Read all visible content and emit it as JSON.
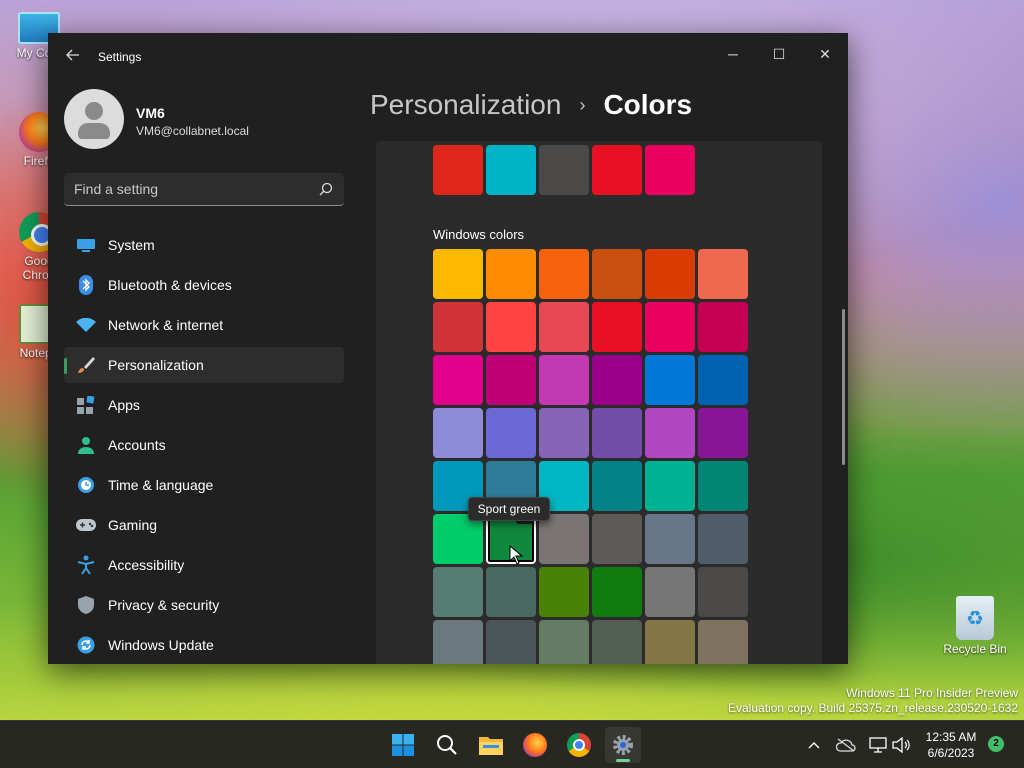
{
  "desktop": {
    "icons": [
      {
        "label": "My Com",
        "icon": "computer-icon"
      },
      {
        "label": "Firefo",
        "icon": "firefox-icon"
      },
      {
        "label": "Goog Chron",
        "icon": "chrome-icon"
      },
      {
        "label": "Notepa",
        "icon": "notepad-icon"
      },
      {
        "label": "Recycle Bin",
        "icon": "recycle-bin-icon"
      }
    ],
    "watermark": {
      "line1": "Windows 11 Pro Insider Preview",
      "line2": "Evaluation copy. Build 25375.zn_release.230520-1632"
    }
  },
  "window": {
    "title": "Settings",
    "back_icon": "back-arrow-icon",
    "controls": {
      "minimize": "─",
      "maximize": "☐",
      "close": "✕"
    },
    "user": {
      "name": "VM6",
      "email": "VM6@collabnet.local"
    },
    "search": {
      "placeholder": "Find a setting",
      "value": ""
    },
    "nav": [
      {
        "label": "System",
        "icon": "system-icon",
        "color": "#3aa0e6"
      },
      {
        "label": "Bluetooth & devices",
        "icon": "bluetooth-icon",
        "color": "#3a8ee6"
      },
      {
        "label": "Network & internet",
        "icon": "wifi-icon",
        "color": "#4cb3f0"
      },
      {
        "label": "Personalization",
        "icon": "brush-icon",
        "color": "#e5884a",
        "active": true
      },
      {
        "label": "Apps",
        "icon": "apps-icon",
        "color": "#9aa3ad"
      },
      {
        "label": "Accounts",
        "icon": "accounts-icon",
        "color": "#2fbf8f"
      },
      {
        "label": "Time & language",
        "icon": "time-language-icon",
        "color": "#3aa0e6"
      },
      {
        "label": "Gaming",
        "icon": "gaming-icon",
        "color": "#bfc6cc"
      },
      {
        "label": "Accessibility",
        "icon": "accessibility-icon",
        "color": "#3aa0e6"
      },
      {
        "label": "Privacy & security",
        "icon": "shield-icon",
        "color": "#9aa3ad"
      },
      {
        "label": "Windows Update",
        "icon": "windows-update-icon",
        "color": "#3aa0e6"
      }
    ],
    "breadcrumb": {
      "parent": "Personalization",
      "separator": "›",
      "current": "Colors"
    },
    "recent_colors": [
      "#e0271c",
      "#00b4c8",
      "#4c4a48",
      "#e81123",
      "#ea005e"
    ],
    "windows_colors_label": "Windows colors",
    "windows_colors": [
      [
        "#ffb900",
        "#ff8c00",
        "#f7630c",
        "#ca5010",
        "#da3b01",
        "#ef6950"
      ],
      [
        "#d13438",
        "#ff4343",
        "#e74856",
        "#e81123",
        "#ea005e",
        "#c30052"
      ],
      [
        "#e3008c",
        "#bf0077",
        "#c239b3",
        "#9a0089",
        "#0078d7",
        "#0063b1"
      ],
      [
        "#8e8cd8",
        "#6b69d6",
        "#8764b8",
        "#744da9",
        "#b146c2",
        "#881798"
      ],
      [
        "#0099bc",
        "#2d7d9a",
        "#00b7c3",
        "#038387",
        "#00b294",
        "#018574"
      ],
      [
        "#00cc6a",
        "#10893e",
        "#7a7574",
        "#5d5a58",
        "#68768a",
        "#515c6b"
      ],
      [
        "#567c73",
        "#486860",
        "#498205",
        "#107c10",
        "#767676",
        "#4c4a48"
      ],
      [
        "#69797e",
        "#4a5459",
        "#647c64",
        "#525e54",
        "#847545",
        "#7e735f"
      ]
    ],
    "selected_color": {
      "row": 5,
      "col": 1,
      "check": "✓"
    },
    "tooltip": "Sport green"
  },
  "taskbar": {
    "apps": [
      {
        "name": "start-icon"
      },
      {
        "name": "search-icon"
      },
      {
        "name": "file-explorer-icon"
      },
      {
        "name": "firefox-icon"
      },
      {
        "name": "chrome-icon"
      },
      {
        "name": "settings-icon",
        "active": true
      }
    ],
    "tray": [
      "chevron-up-icon",
      "onedrive-icon",
      "network-icon",
      "volume-icon"
    ],
    "time": "12:35 AM",
    "date": "6/6/2023",
    "notifications": "2"
  }
}
